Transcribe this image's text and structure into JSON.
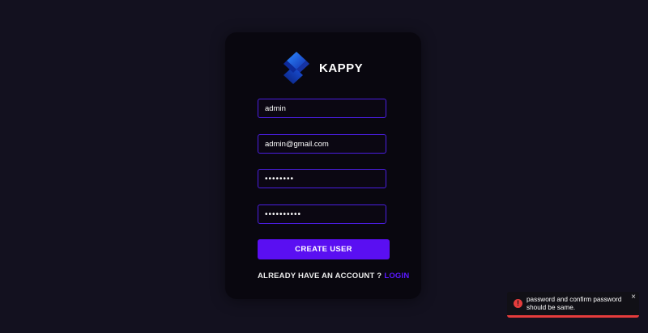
{
  "brand": {
    "name": "KAPPY",
    "logo_icon": "kappy-s-logo-icon"
  },
  "form": {
    "username": {
      "value": "admin"
    },
    "email": {
      "value": "admin@gmail.com"
    },
    "password": {
      "value": "••••••••"
    },
    "confirm_password": {
      "value": "••••••••••"
    },
    "submit_label": "CREATE USER",
    "login_prompt": "ALREADY HAVE AN ACCOUNT ?",
    "login_link": "LOGIN"
  },
  "toast": {
    "message": "password and confirm password should be same.",
    "icon": "error-icon",
    "close_label": "×",
    "progress": 1.0
  },
  "colors": {
    "background": "#13111f",
    "card": "#09070f",
    "accent": "#5a0ff2",
    "input_border": "#4a1ee0",
    "error": "#e53c3c"
  }
}
